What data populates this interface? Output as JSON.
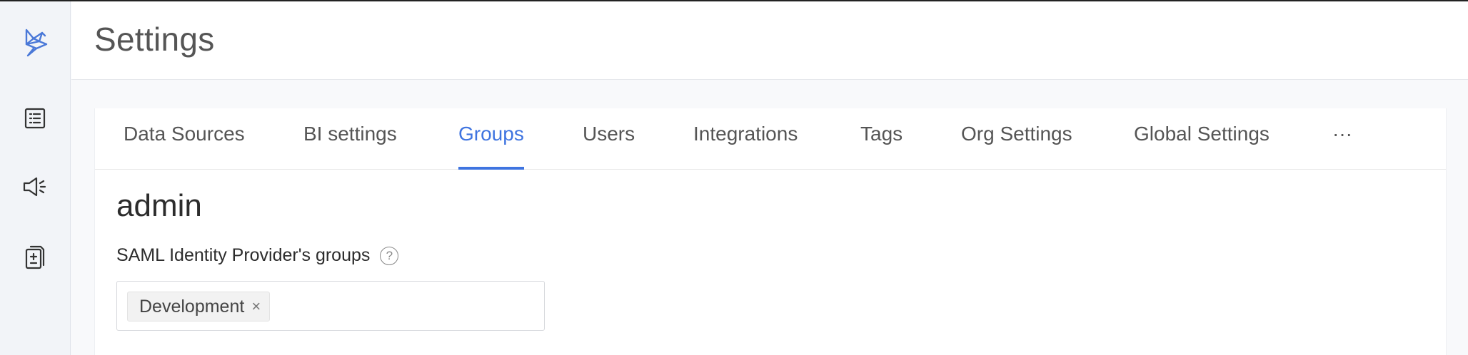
{
  "sidebar": {
    "items": [
      {
        "icon": "logo-bird-icon"
      },
      {
        "icon": "list-icon"
      },
      {
        "icon": "megaphone-icon"
      },
      {
        "icon": "document-diff-icon"
      }
    ],
    "accent": "#4a78d8"
  },
  "header": {
    "title": "Settings"
  },
  "tabs": [
    {
      "label": "Data Sources",
      "active": false
    },
    {
      "label": "BI settings",
      "active": false
    },
    {
      "label": "Groups",
      "active": true
    },
    {
      "label": "Users",
      "active": false
    },
    {
      "label": "Integrations",
      "active": false
    },
    {
      "label": "Tags",
      "active": false
    },
    {
      "label": "Org Settings",
      "active": false
    },
    {
      "label": "Global Settings",
      "active": false
    },
    {
      "label": "···",
      "active": false
    }
  ],
  "group": {
    "name": "admin",
    "saml_label": "SAML Identity Provider's groups",
    "help_glyph": "?",
    "tags": [
      {
        "label": "Development",
        "close_glyph": "×"
      }
    ]
  },
  "colors": {
    "active_tab": "#3f74e0",
    "text": "#555555"
  }
}
